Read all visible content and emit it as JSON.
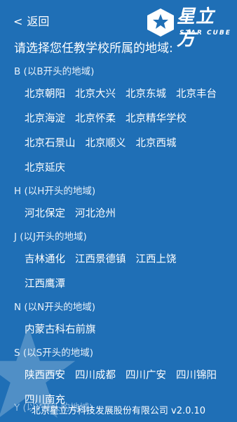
{
  "header": {
    "back_label": "返回",
    "logo_cn": "星立方",
    "logo_en": "STAR CUBE"
  },
  "prompt": "请选择您任教学校所属的地域:",
  "groups": [
    {
      "title": "B (以B开头的地域)",
      "items": [
        "北京朝阳",
        "北京大兴",
        "北京东城",
        "北京丰台",
        "北京海淀",
        "北京怀柔",
        "北京精华学校",
        "北京石景山",
        "北京顺义",
        "北京西城",
        "北京延庆"
      ]
    },
    {
      "title": "H (以H开头的地域)",
      "items": [
        "河北保定",
        "河北沧州"
      ]
    },
    {
      "title": "J (以J开头的地域)",
      "items": [
        "吉林通化",
        "江西景德镇",
        "江西上饶",
        "江西鹰潭"
      ]
    },
    {
      "title": "N (以N开头的地域)",
      "items": [
        "内蒙古科右前旗"
      ]
    },
    {
      "title": "S (以S开头的地域)",
      "items": [
        "陕西西安",
        "四川成都",
        "四川广安",
        "四川锦阳",
        "四川南充"
      ]
    }
  ],
  "partial_group_title": "Y (以Y开头的地域)",
  "footer": "北京星立方科技发展股份有限公司 v2.0.10",
  "colors": {
    "background": "#1f6fb6",
    "text": "#ffffff"
  }
}
